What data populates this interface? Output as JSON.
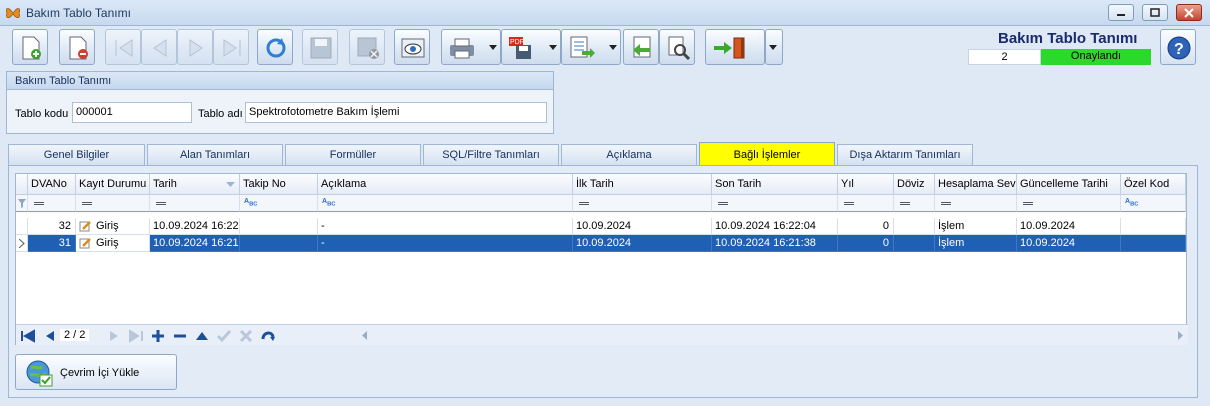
{
  "window": {
    "title": "Bakım Tablo Tanımı"
  },
  "header": {
    "title": "Bakım Tablo Tanımı",
    "record_id": "2",
    "status": "Onaylandı",
    "status_color": "#2bd82b"
  },
  "form": {
    "group_title": "Bakım Tablo Tanımı",
    "code_label": "Tablo kodu",
    "code_value": "000001",
    "name_label": "Tablo adı",
    "name_value": "Spektrofotometre Bakım İşlemi"
  },
  "tabs": [
    "Genel Bilgiler",
    "Alan Tanımları",
    "Formüller",
    "SQL/Filtre Tanımları",
    "Açıklama",
    "Bağlı İşlemler",
    "Dışa Aktarım Tanımları"
  ],
  "active_tab": "Bağlı İşlemler",
  "grid": {
    "columns": [
      "DVANo",
      "Kayıt Durumu",
      "Tarih",
      "Takip No",
      "Açıklama",
      "İlk Tarih",
      "Son Tarih",
      "Yıl",
      "Döviz",
      "Hesaplama Sevi",
      "Güncelleme Tarihi",
      "Özel Kod"
    ],
    "rows": [
      {
        "dvano": "32",
        "status": "Giriş",
        "tarih": "10.09.2024 16:22",
        "takip": "",
        "aciklama": "-",
        "ilk": "10.09.2024",
        "son": "10.09.2024 16:22:04",
        "yil": "0",
        "doviz": "",
        "hesap": "İşlem",
        "guncel": "10.09.2024",
        "ozel": ""
      },
      {
        "dvano": "31",
        "status": "Giriş",
        "tarih": "10.09.2024 16:21",
        "takip": "",
        "aciklama": "-",
        "ilk": "10.09.2024",
        "son": "10.09.2024 16:21:38",
        "yil": "0",
        "doviz": "",
        "hesap": "İşlem",
        "guncel": "10.09.2024",
        "ozel": ""
      }
    ],
    "page_indicator": "2 / 2",
    "selected_color": "#1f5fb4"
  },
  "actions": {
    "load_label": "Çevrim İçi Yükle"
  },
  "icons": [
    "new-document-icon",
    "delete-document-icon",
    "first-record-icon",
    "previous-record-icon",
    "next-record-icon",
    "last-record-icon",
    "refresh-icon",
    "save-icon",
    "save-close-icon",
    "preview-icon",
    "print-icon",
    "pdf-save-icon",
    "export-icon",
    "import-icon",
    "tools-icon",
    "exit-door-icon",
    "help-icon"
  ]
}
